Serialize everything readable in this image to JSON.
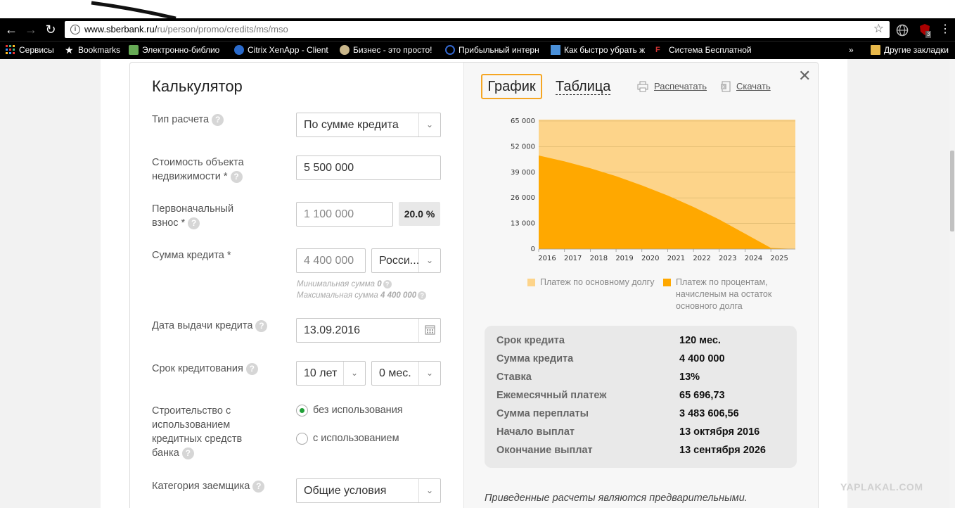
{
  "browser": {
    "url_host": "www.sberbank.ru/",
    "url_path": "ru/person/promo/credits/ms/mso",
    "ext_badge": "3"
  },
  "bookmarks": {
    "items": [
      "Сервисы",
      "Bookmarks",
      "Электронно-библио",
      "Citrix XenApp - Client",
      "Бизнес - это просто!",
      "Прибыльный интерн",
      "Как быстро убрать ж",
      "Система Бесплатной"
    ],
    "overflow": "»",
    "other": "Другие закладки"
  },
  "calculator": {
    "title": "Калькулятор",
    "calc_type": {
      "label": "Тип расчета",
      "value": "По сумме кредита"
    },
    "property_cost": {
      "label_line1": "Стоимость объекта",
      "label_line2": "недвижимости *",
      "value": "5 500 000"
    },
    "down_payment": {
      "label_line1": "Первоначальный",
      "label_line2": "взнос *",
      "value": "1 100 000",
      "percent": "20.0 %"
    },
    "loan_amount": {
      "label": "Сумма кредита *",
      "value": "4 400 000",
      "currency": "Росси...",
      "min_text": "Минимальная сумма",
      "min_value": "0",
      "max_text": "Максимальная сумма",
      "max_value": "4 400 000"
    },
    "issue_date": {
      "label": "Дата выдачи кредита",
      "value": "13.09.2016"
    },
    "term": {
      "label": "Срок кредитования",
      "years": "10 лет",
      "months": "0 мес."
    },
    "construction": {
      "label_lines": [
        "Строительство с",
        "использованием",
        "кредитных средств",
        "банка"
      ],
      "option_without": "без использования",
      "option_with": "с использованием",
      "selected": "without"
    },
    "borrower_category": {
      "label": "Категория заемщика",
      "value": "Общие условия"
    }
  },
  "results": {
    "tab_graph": "График",
    "tab_table": "Таблица",
    "print_label": "Распечатать",
    "download_label": "Скачать",
    "legend_principal": "Платеж по основному долгу",
    "legend_interest_lines": [
      "Платеж по процентам,",
      "начисленым на остаток",
      "основного долга"
    ],
    "summary_rows": [
      {
        "key": "Срок кредита",
        "value": "120 мес."
      },
      {
        "key": "Сумма кредита",
        "value": "4 400 000"
      },
      {
        "key": "Ставка",
        "value": "13%"
      },
      {
        "key": "Ежемесячный платеж",
        "value": "65 696,73"
      },
      {
        "key": "Сумма переплаты",
        "value": "3 483 606,56"
      },
      {
        "key": "Начало выплат",
        "value": "13 октября 2016"
      },
      {
        "key": "Окончание выплат",
        "value": "13 сентября 2026"
      }
    ],
    "disclaimer": "Приведенные расчеты являются предварительными."
  },
  "chart_data": {
    "type": "area",
    "x": [
      "2016",
      "2017",
      "2018",
      "2019",
      "2020",
      "2021",
      "2022",
      "2023",
      "2024",
      "2025"
    ],
    "y_ticks": [
      "0",
      "13 000",
      "26 000",
      "39 000",
      "52 000",
      "65 000"
    ],
    "ylim": [
      0,
      65696.73
    ],
    "series": [
      {
        "name": "Платеж по основному долгу",
        "color": "#fdd48a",
        "values": [
          65697,
          65697,
          65697,
          65697,
          65697,
          65697,
          65697,
          65697,
          65697,
          65697
        ]
      },
      {
        "name": "Платеж по процентам, начисленым на остаток основного долга",
        "color": "#ffa800",
        "values": [
          47500,
          44500,
          41000,
          37000,
          32300,
          27200,
          21400,
          15000,
          7800,
          600
        ]
      }
    ]
  },
  "watermark": "YAPLAKAL.COM",
  "colors": {
    "accent": "#f5a623",
    "area_light": "#fdd48a",
    "area_dark": "#ffa800",
    "radio_on": "#21a038"
  }
}
